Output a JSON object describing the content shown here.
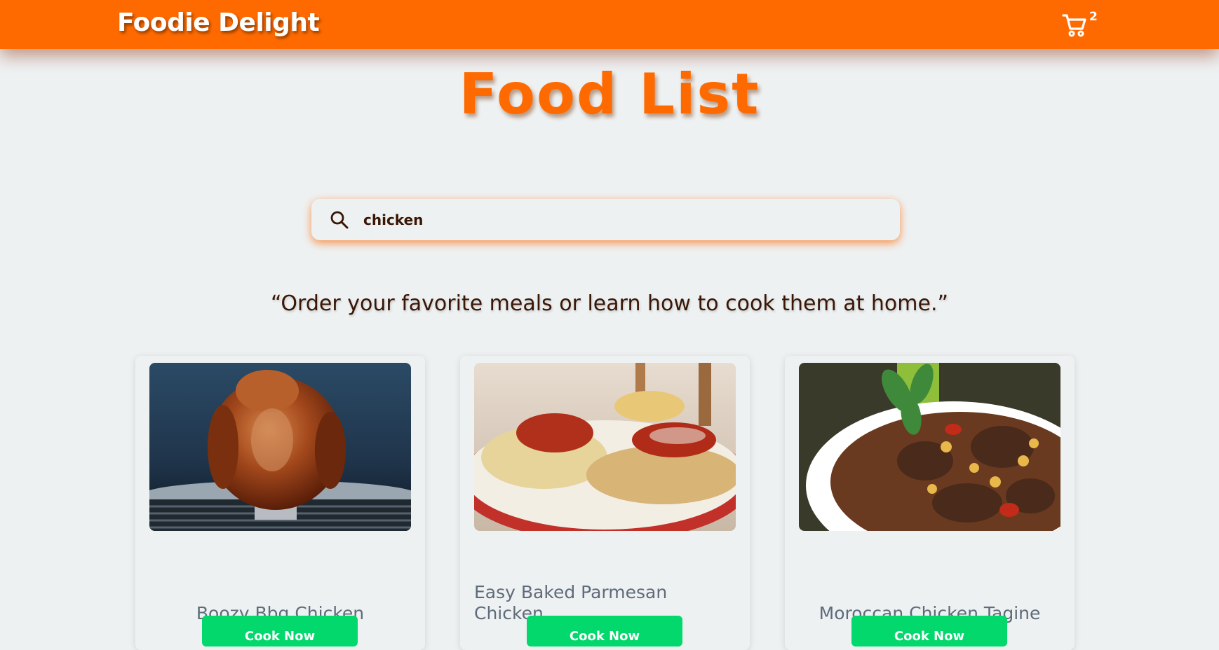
{
  "header": {
    "brand": "Foodie Delight",
    "cart_count": "2",
    "cart_icon": "shopping-cart-icon",
    "bg_color": "#ff6a00"
  },
  "page": {
    "title": "Food List",
    "tagline": "“Order your favorite meals or learn how to cook them at home.”"
  },
  "search": {
    "icon": "search-icon",
    "value": "chicken",
    "placeholder": ""
  },
  "cards": [
    {
      "title": "Boozy Bbq Chicken",
      "button": "Cook Now",
      "image": "roasted-bbq-chicken-photo"
    },
    {
      "title": "Easy Baked Parmesan Chicken",
      "button": "Cook Now",
      "image": "parmesan-chicken-spaghetti-photo"
    },
    {
      "title": "Moroccan Chicken Tagine",
      "button": "Cook Now",
      "image": "chicken-tagine-stew-photo"
    }
  ],
  "colors": {
    "accent": "#ff6a00",
    "button": "#02d86b",
    "background": "#eef1f2",
    "text_dark": "#3a1605",
    "card_title": "#5f6b7a"
  }
}
